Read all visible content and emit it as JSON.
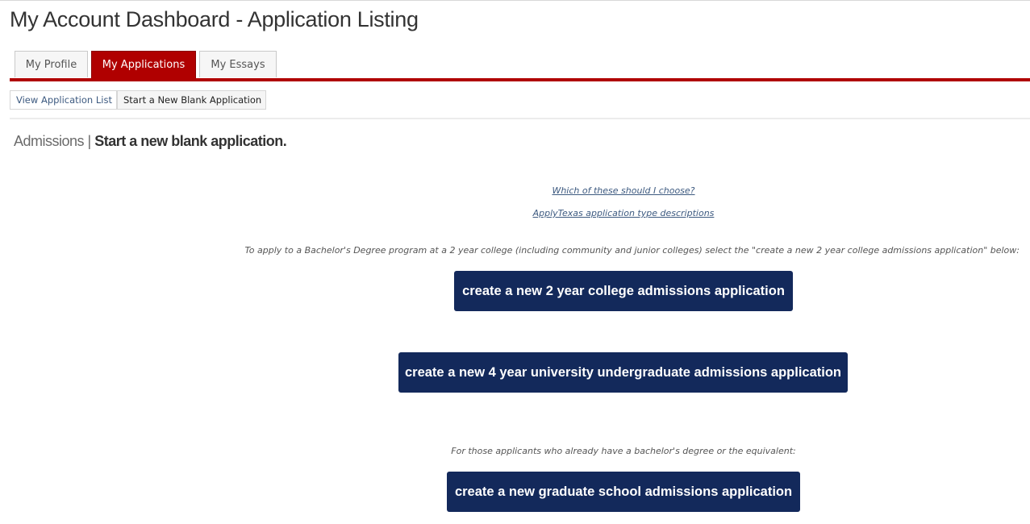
{
  "page": {
    "title": "My Account Dashboard - Application Listing"
  },
  "tabs": [
    {
      "label": "My Profile",
      "active": false
    },
    {
      "label": "My Applications",
      "active": true
    },
    {
      "label": "My Essays",
      "active": false
    }
  ],
  "subnav": {
    "view_list": "View Application List",
    "start_blank": "Start a New Blank Application"
  },
  "section": {
    "crumb": "Admissions",
    "separator": " | ",
    "current": "Start a new blank application."
  },
  "help_links": {
    "which": "Which of these should I choose?",
    "types": "ApplyTexas application type descriptions"
  },
  "notes": {
    "two_year": "To apply to a Bachelor's Degree program at a 2 year college (including community and junior colleges) select the \"create a new 2 year college admissions application\" below:",
    "graduate": "For those applicants who already have a bachelor's degree or the equivalent:"
  },
  "buttons": {
    "two_year": "create a new 2 year college admissions application",
    "four_year": "create a new 4 year university undergraduate admissions application",
    "graduate": "create a new graduate school admissions application"
  },
  "colors": {
    "accent_red": "#b00000",
    "button_navy": "#13295b",
    "link_blue": "#3d5a80"
  }
}
